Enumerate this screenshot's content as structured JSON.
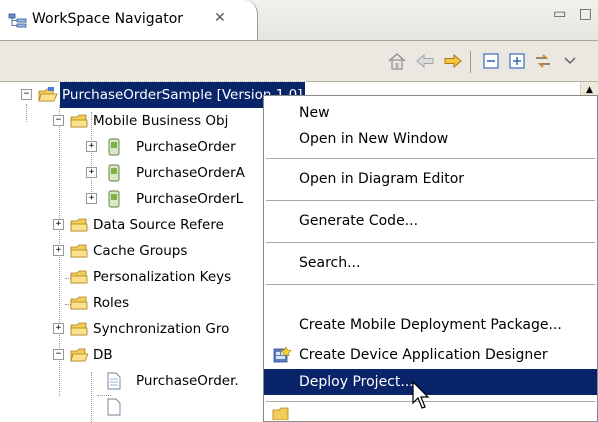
{
  "view": {
    "title": "WorkSpace Navigator",
    "close_glyph": "✕",
    "minimize_glyph": "▭",
    "maximize_glyph": "□"
  },
  "toolbar": {
    "icons": [
      "home-icon",
      "back-arrow-icon",
      "forward-arrow-icon",
      "collapse-all-icon",
      "expand-all-icon",
      "link-with-editor-icon",
      "view-menu-icon"
    ]
  },
  "tree": {
    "root": "PurchaseOrderSample [Version 1.0]",
    "items": [
      {
        "label": "Mobile Business Obj",
        "icon": "folder-icon",
        "expander": "−"
      },
      {
        "label": "PurchaseOrder",
        "icon": "mbo-icon",
        "expander": "+"
      },
      {
        "label": "PurchaseOrderA",
        "icon": "mbo-icon",
        "expander": "+"
      },
      {
        "label": "PurchaseOrderL",
        "icon": "mbo-icon",
        "expander": "+"
      },
      {
        "label": "Data Source Refere",
        "icon": "folder-icon",
        "expander": "+"
      },
      {
        "label": "Cache Groups",
        "icon": "folder-icon",
        "expander": "+"
      },
      {
        "label": "Personalization Keys",
        "icon": "folder-icon",
        "expander": ""
      },
      {
        "label": "Roles",
        "icon": "folder-icon",
        "expander": ""
      },
      {
        "label": "Synchronization Gro",
        "icon": "folder-icon",
        "expander": "+"
      },
      {
        "label": "DB",
        "icon": "folder-open-icon",
        "expander": "−"
      },
      {
        "label": "PurchaseOrder.",
        "icon": "file-icon",
        "expander": ""
      }
    ]
  },
  "context_menu": {
    "items": [
      {
        "label": "New"
      },
      {
        "label": "Open in New Window"
      },
      {
        "label": "Open in Diagram Editor"
      },
      {
        "label": "Generate Code..."
      },
      {
        "label": "Search..."
      },
      {
        "label": "Create Mobile Deployment Package..."
      },
      {
        "label": "Create Device Application Designer",
        "icon": "device-designer-icon"
      },
      {
        "label": "Deploy Project...",
        "highlighted": true
      }
    ]
  },
  "colors": {
    "selection": "#0a246a",
    "menu_border": "#8a8a8a",
    "toolbar_bg": "#eae8e1"
  }
}
